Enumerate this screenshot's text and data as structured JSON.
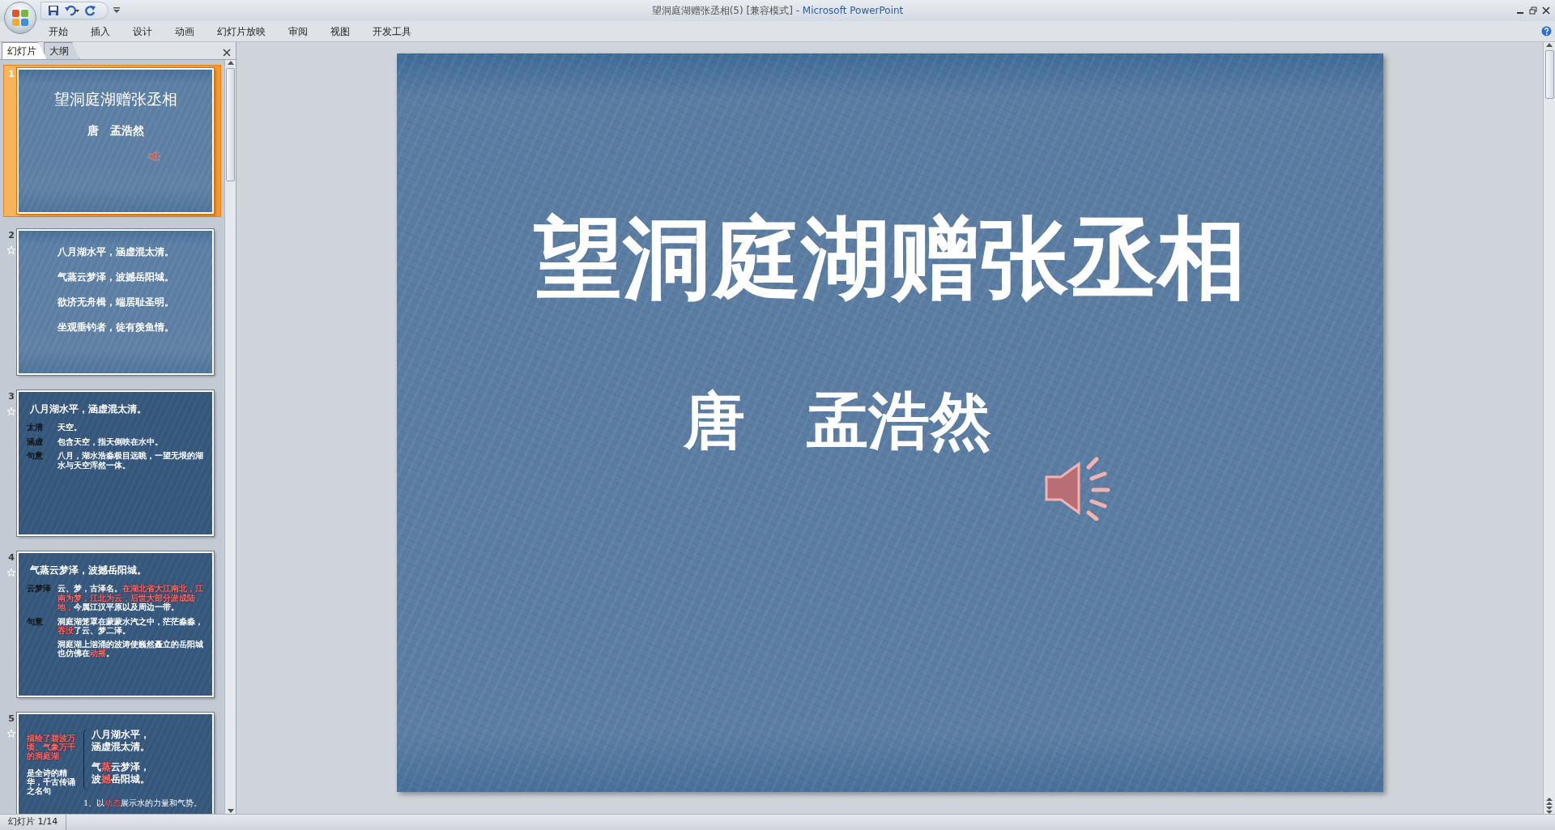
{
  "window": {
    "document_title": "望洞庭湖赠张丞相(5) [兼容模式]",
    "app_name": "- Microsoft PowerPoint"
  },
  "ribbon_tabs": [
    {
      "label": "开始"
    },
    {
      "label": "插入"
    },
    {
      "label": "设计"
    },
    {
      "label": "动画"
    },
    {
      "label": "幻灯片放映"
    },
    {
      "label": "审阅"
    },
    {
      "label": "视图"
    },
    {
      "label": "开发工具"
    }
  ],
  "pane_tabs": [
    {
      "label": "幻灯片",
      "selected": true
    },
    {
      "label": "大纲",
      "selected": false
    }
  ],
  "thumbnails": [
    {
      "number": "1",
      "kind": "title",
      "selected": true,
      "animated": false,
      "title": "望洞庭湖赠张丞相",
      "subtitle": "唐　孟浩然"
    },
    {
      "number": "2",
      "kind": "lines",
      "selected": false,
      "animated": true,
      "lines": [
        "八月湖水平，涵虚混太清。",
        "气蒸云梦泽，波撼岳阳城。",
        "欲济无舟楫，端居耻圣明。",
        "坐观垂钓者，徒有羡鱼情。"
      ]
    },
    {
      "number": "3",
      "kind": "glossary",
      "selected": false,
      "animated": true,
      "heading": "八月湖水平，涵虚混太清。",
      "entries": [
        {
          "term": "太清",
          "paragraphs": [
            [
              {
                "text": "天空。",
                "highlighted": false
              }
            ]
          ]
        },
        {
          "term": "涵虚",
          "paragraphs": [
            [
              {
                "text": "包含天空，指天倒映在水中。",
                "highlighted": false
              }
            ]
          ]
        },
        {
          "term": "句意",
          "paragraphs": [
            [
              {
                "text": "八月，湖水浩淼极目远眺，一望无垠的湖水与天空浑然一体。",
                "highlighted": false
              }
            ]
          ]
        }
      ]
    },
    {
      "number": "4",
      "kind": "glossary",
      "selected": false,
      "animated": true,
      "heading": "气蒸云梦泽，波撼岳阳城。",
      "entries": [
        {
          "term": "云梦泽",
          "paragraphs": [
            [
              {
                "text": "云、梦，古泽名。",
                "highlighted": false
              },
              {
                "text": "在湖北省大江南北，江南为梦，江北为云，后世大部分淤成陆地，",
                "highlighted": true
              },
              {
                "text": "今属江汉平原以及周边一带。",
                "highlighted": false
              }
            ]
          ]
        },
        {
          "term": "句意",
          "paragraphs": [
            [
              {
                "text": "洞庭湖笼罩在蒙蒙水汽之中，茫茫淼淼，",
                "highlighted": false
              },
              {
                "text": "吞没",
                "highlighted": true
              },
              {
                "text": "了云、梦二泽。",
                "highlighted": false
              }
            ],
            [
              {
                "text": "洞庭湖上汹涌的波涛使巍然矗立的岳阳城也仿佛在",
                "highlighted": false
              },
              {
                "text": "动摇",
                "highlighted": true
              },
              {
                "text": "。",
                "highlighted": false
              }
            ]
          ]
        }
      ]
    },
    {
      "number": "5",
      "kind": "analysis",
      "selected": false,
      "animated": true,
      "notes": [
        {
          "text": "描绘了碧波万顷、气象万千的洞庭湖",
          "highlighted": true
        },
        {
          "text": "是全诗的精华，千古传诵之名句",
          "highlighted": false
        }
      ],
      "lines": [
        [
          {
            "text": "八月湖水平，",
            "highlighted": false
          }
        ],
        [
          {
            "text": "涵虚混太清。",
            "highlighted": false
          }
        ],
        [
          {
            "text": "气",
            "highlighted": false
          },
          {
            "text": "蒸",
            "highlighted": true
          },
          {
            "text": "云梦泽，",
            "highlighted": false
          }
        ],
        [
          {
            "text": "波",
            "highlighted": false
          },
          {
            "text": "撼",
            "highlighted": true
          },
          {
            "text": "岳阳城。",
            "highlighted": false
          }
        ]
      ],
      "footer": [
        {
          "text": "1、以",
          "highlighted": false
        },
        {
          "text": "动态",
          "highlighted": true
        },
        {
          "text": "展示水的力量和气势。",
          "highlighted": false
        }
      ]
    }
  ],
  "slide": {
    "title": "望洞庭湖赠张丞相",
    "author": "唐　孟浩然"
  },
  "status_bar": {
    "slide_indicator": "幻灯片 1/14"
  }
}
